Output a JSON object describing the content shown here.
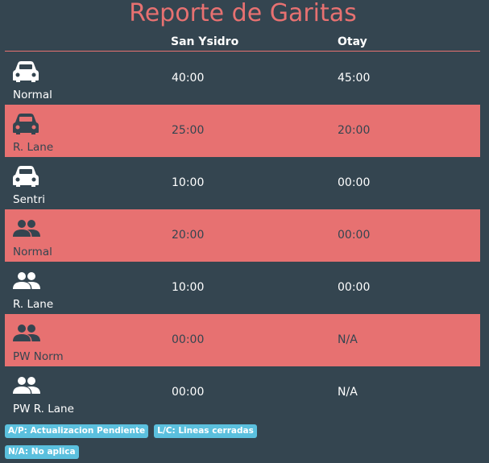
{
  "title": "Reporte de Garitas",
  "headers": {
    "san_ysidro": "San Ysidro",
    "otay": "Otay"
  },
  "rows": [
    {
      "icon": "car-icon",
      "label": "Normal",
      "san_ysidro": "40:00",
      "otay": "45:00",
      "highlight": false
    },
    {
      "icon": "car-icon",
      "label": "R. Lane",
      "san_ysidro": "25:00",
      "otay": "20:00",
      "highlight": true
    },
    {
      "icon": "car-icon",
      "label": "Sentri",
      "san_ysidro": "10:00",
      "otay": "00:00",
      "highlight": false
    },
    {
      "icon": "people-icon",
      "label": "Normal",
      "san_ysidro": "20:00",
      "otay": "00:00",
      "highlight": true
    },
    {
      "icon": "people-icon",
      "label": "R. Lane",
      "san_ysidro": "10:00",
      "otay": "00:00",
      "highlight": false
    },
    {
      "icon": "people-icon",
      "label": "PW Norm",
      "san_ysidro": "00:00",
      "otay": "N/A",
      "highlight": true
    },
    {
      "icon": "people-icon",
      "label": "PW R. Lane",
      "san_ysidro": "00:00",
      "otay": "N/A",
      "highlight": false
    }
  ],
  "legend": [
    "A/P: Actualizacion Pendiente",
    "L/C: Lineas cerradas",
    "N/A: No aplica"
  ],
  "colors": {
    "background": "#344550",
    "accent": "#e77171",
    "badge": "#5bc0de",
    "text": "#ffffff"
  }
}
